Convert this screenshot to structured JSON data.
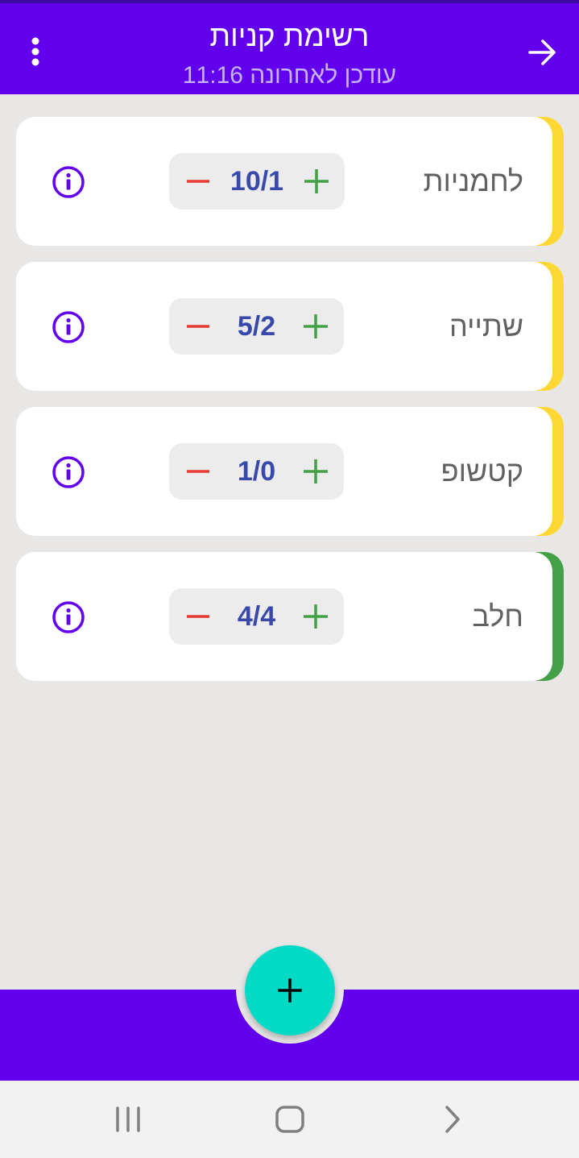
{
  "colors": {
    "primary": "#6200ee",
    "accent": "#03dac5",
    "status_partial": "#fdd835",
    "status_complete": "#43a047",
    "minus": "#e53935",
    "plus": "#43a047",
    "quantity_text": "#3949ab",
    "info_icon": "#6200ee"
  },
  "appbar": {
    "title": "רשימת קניות",
    "subtitle": "עודכן לאחרונה 11:16",
    "menu_icon": "more-vert-icon",
    "back_icon": "arrow-forward-icon"
  },
  "items": [
    {
      "name": "לחמניות",
      "quantity": "10/1",
      "status": "partial"
    },
    {
      "name": "שתייה",
      "quantity": "5/2",
      "status": "partial"
    },
    {
      "name": "קטשופ",
      "quantity": "1/0",
      "status": "partial"
    },
    {
      "name": "חלב",
      "quantity": "4/4",
      "status": "complete"
    }
  ],
  "fab": {
    "icon": "plus-icon"
  },
  "system_nav": {
    "recents_icon": "recents-icon",
    "home_icon": "home-icon",
    "back_icon": "back-chevron-icon"
  }
}
